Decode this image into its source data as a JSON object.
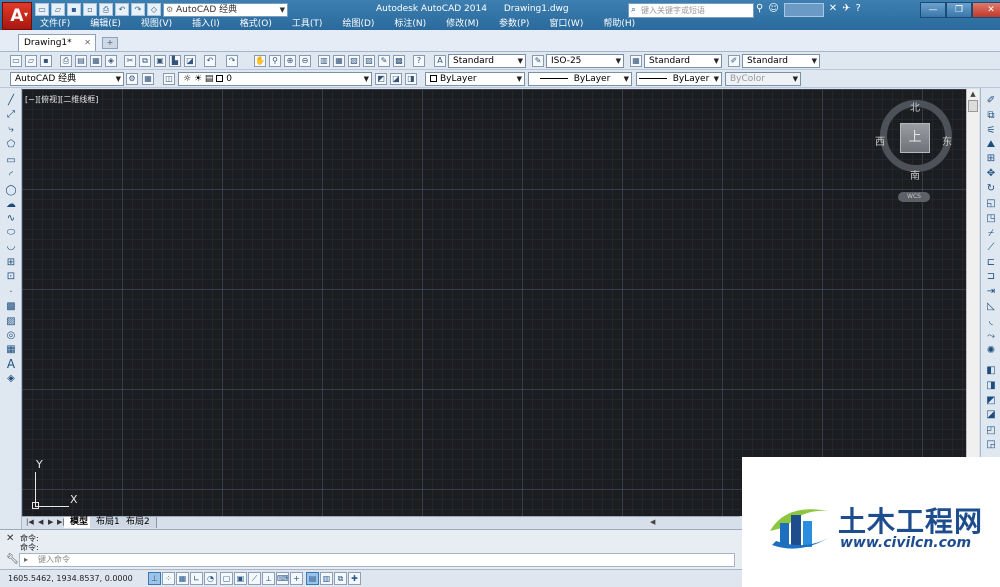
{
  "app": {
    "logo_letter": "A"
  },
  "title_bar": {
    "workspace": "AutoCAD 经典",
    "product": "Autodesk AutoCAD 2014",
    "document": "Drawing1.dwg",
    "help_search_placeholder": "键入关键字或短语"
  },
  "menu": [
    "文件(F)",
    "编辑(E)",
    "视图(V)",
    "插入(I)",
    "格式(O)",
    "工具(T)",
    "绘图(D)",
    "标注(N)",
    "修改(M)",
    "参数(P)",
    "窗口(W)",
    "帮助(H)"
  ],
  "doc_tabs": {
    "active": "Drawing1*"
  },
  "standard_toolbar": {
    "text_style": "Standard",
    "dim_style": "ISO-25",
    "table_style": "Standard",
    "mleader_style": "Standard"
  },
  "properties_toolbar": {
    "workspace": "AutoCAD 经典",
    "layer": "0",
    "color": "ByLayer",
    "linetype": "ByLayer",
    "lineweight": "ByLayer",
    "plotstyle": "ByColor"
  },
  "canvas": {
    "viewport_label": "[−][俯视][二维线框]",
    "background_color": "#1b1d21"
  },
  "viewcube": {
    "north": "北",
    "south": "南",
    "east": "东",
    "west": "西",
    "face": "上",
    "wcs": "WCS"
  },
  "ucs": {
    "x": "X",
    "y": "Y"
  },
  "layout_tabs": [
    "模型",
    "布局1",
    "布局2"
  ],
  "command_line": {
    "history": [
      "命令:",
      "命令:"
    ],
    "input_placeholder": "键入命令"
  },
  "status_bar": {
    "coordinates": "1605.5462, 1934.8537, 0.0000"
  },
  "watermark": {
    "title": "土木工程网",
    "url": "www.civilcn.com"
  },
  "colors": {
    "accent": "#2a6a9c",
    "canvas": "#1b1d21",
    "watermark_blue": "#1e4d8e"
  }
}
